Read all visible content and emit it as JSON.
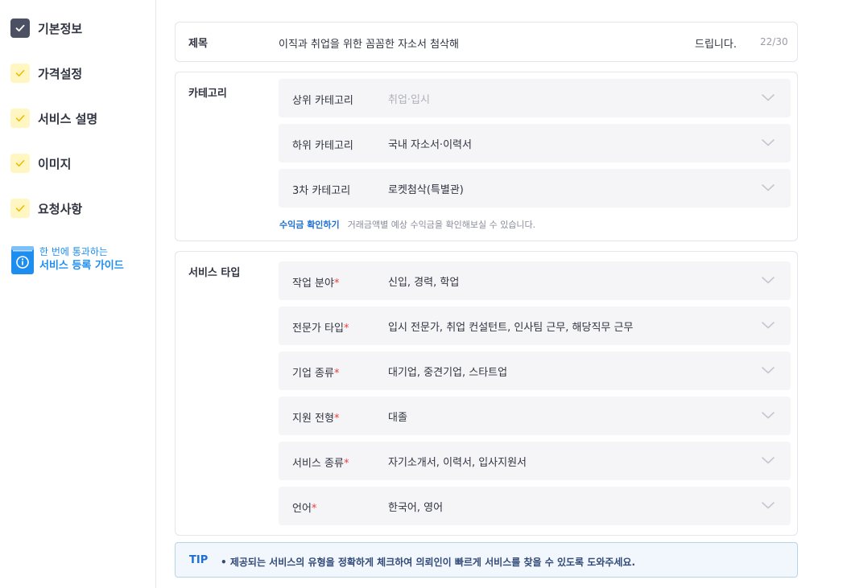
{
  "sidebar": {
    "steps": [
      {
        "label": "기본정보",
        "state": "done"
      },
      {
        "label": "가격설정",
        "state": "todo"
      },
      {
        "label": "서비스 설명",
        "state": "todo"
      },
      {
        "label": "이미지",
        "state": "todo"
      },
      {
        "label": "요청사항",
        "state": "todo"
      }
    ],
    "guide": {
      "line1": "한 번에 통과하는",
      "line2": "서비스 등록 가이드",
      "icon": "guide-book-icon"
    }
  },
  "title_section": {
    "label": "제목",
    "value": "이직과 취업을 위한 꼼꼼한 자소서 첨삭해",
    "suffix": "드립니다.",
    "counter": "22/30"
  },
  "category_section": {
    "label": "카테고리",
    "selects": [
      {
        "label": "상위 카테고리",
        "value": "취업·입시",
        "disabled": true
      },
      {
        "label": "하위 카테고리",
        "value": "국내 자소서·이력서"
      },
      {
        "label": "3차 카테고리",
        "value": "로켓첨삭(특별관)"
      }
    ],
    "hint_link": "수익금 확인하기",
    "hint_text": "거래금액별 예상 수익금을 확인해보실 수 있습니다."
  },
  "service_section": {
    "label": "서비스 타입",
    "selects": [
      {
        "label": "작업 분야",
        "required": "*",
        "value": "신입, 경력, 학업"
      },
      {
        "label": "전문가 타입",
        "required": "*",
        "value": "입시 전문가, 취업 컨설턴트, 인사팀 근무, 해당직무 근무"
      },
      {
        "label": "기업 종류",
        "required": "*",
        "value": "대기업, 중견기업, 스타트업"
      },
      {
        "label": "지원 전형",
        "required": "*",
        "value": "대졸"
      },
      {
        "label": "서비스 종류",
        "required": "*",
        "value": "자기소개서, 이력서, 입사지원서"
      },
      {
        "label": "언어",
        "required": "*",
        "value": "한국어, 영어"
      }
    ]
  },
  "tip": {
    "label": "TIP",
    "text": "• 제공되는 서비스의 유형을 정확하게 체크하여 의뢰인이 빠르게 서비스를 찾을 수 있도록 도와주세요."
  },
  "colors": {
    "accent": "#1d8df0",
    "done_box": "#4b5063",
    "todo_box": "#fff6c2",
    "todo_check": "#f5b800",
    "required": "#e8423d"
  }
}
